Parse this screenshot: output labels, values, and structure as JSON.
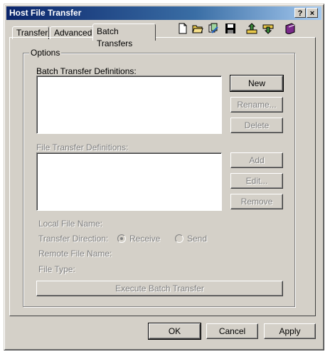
{
  "window": {
    "title": "Host File Transfer",
    "help_btn": "?",
    "close_btn": "×"
  },
  "tabs": [
    {
      "label": "Transfer",
      "active": false
    },
    {
      "label": "Advanced",
      "active": false
    },
    {
      "label": "Batch Transfers",
      "active": true
    }
  ],
  "toolbar": {
    "icons": [
      "new-file-icon",
      "open-folder-icon",
      "edit-sheets-icon",
      "save-disk-icon",
      "upload-tray-icon",
      "download-tray-icon",
      "book-icon"
    ]
  },
  "options": {
    "group_label": "Options",
    "batch_defs_label": "Batch Transfer Definitions:",
    "file_defs_label": "File Transfer Definitions:",
    "local_file_name_label": "Local File Name:",
    "transfer_direction_label": "Transfer Direction:",
    "receive_label": "Receive",
    "send_label": "Send",
    "remote_file_name_label": "Remote File Name:",
    "file_type_label": "File Type:"
  },
  "buttons": {
    "new": "New",
    "rename": "Rename...",
    "delete": "Delete",
    "add": "Add",
    "edit": "Edit...",
    "remove": "Remove",
    "execute": "Execute Batch Transfer",
    "ok": "OK",
    "cancel": "Cancel",
    "apply": "Apply"
  },
  "colors": {
    "title_start": "#0a246a",
    "title_end": "#a6caf0",
    "face": "#d4d0c8",
    "disabled_text": "#808080"
  }
}
